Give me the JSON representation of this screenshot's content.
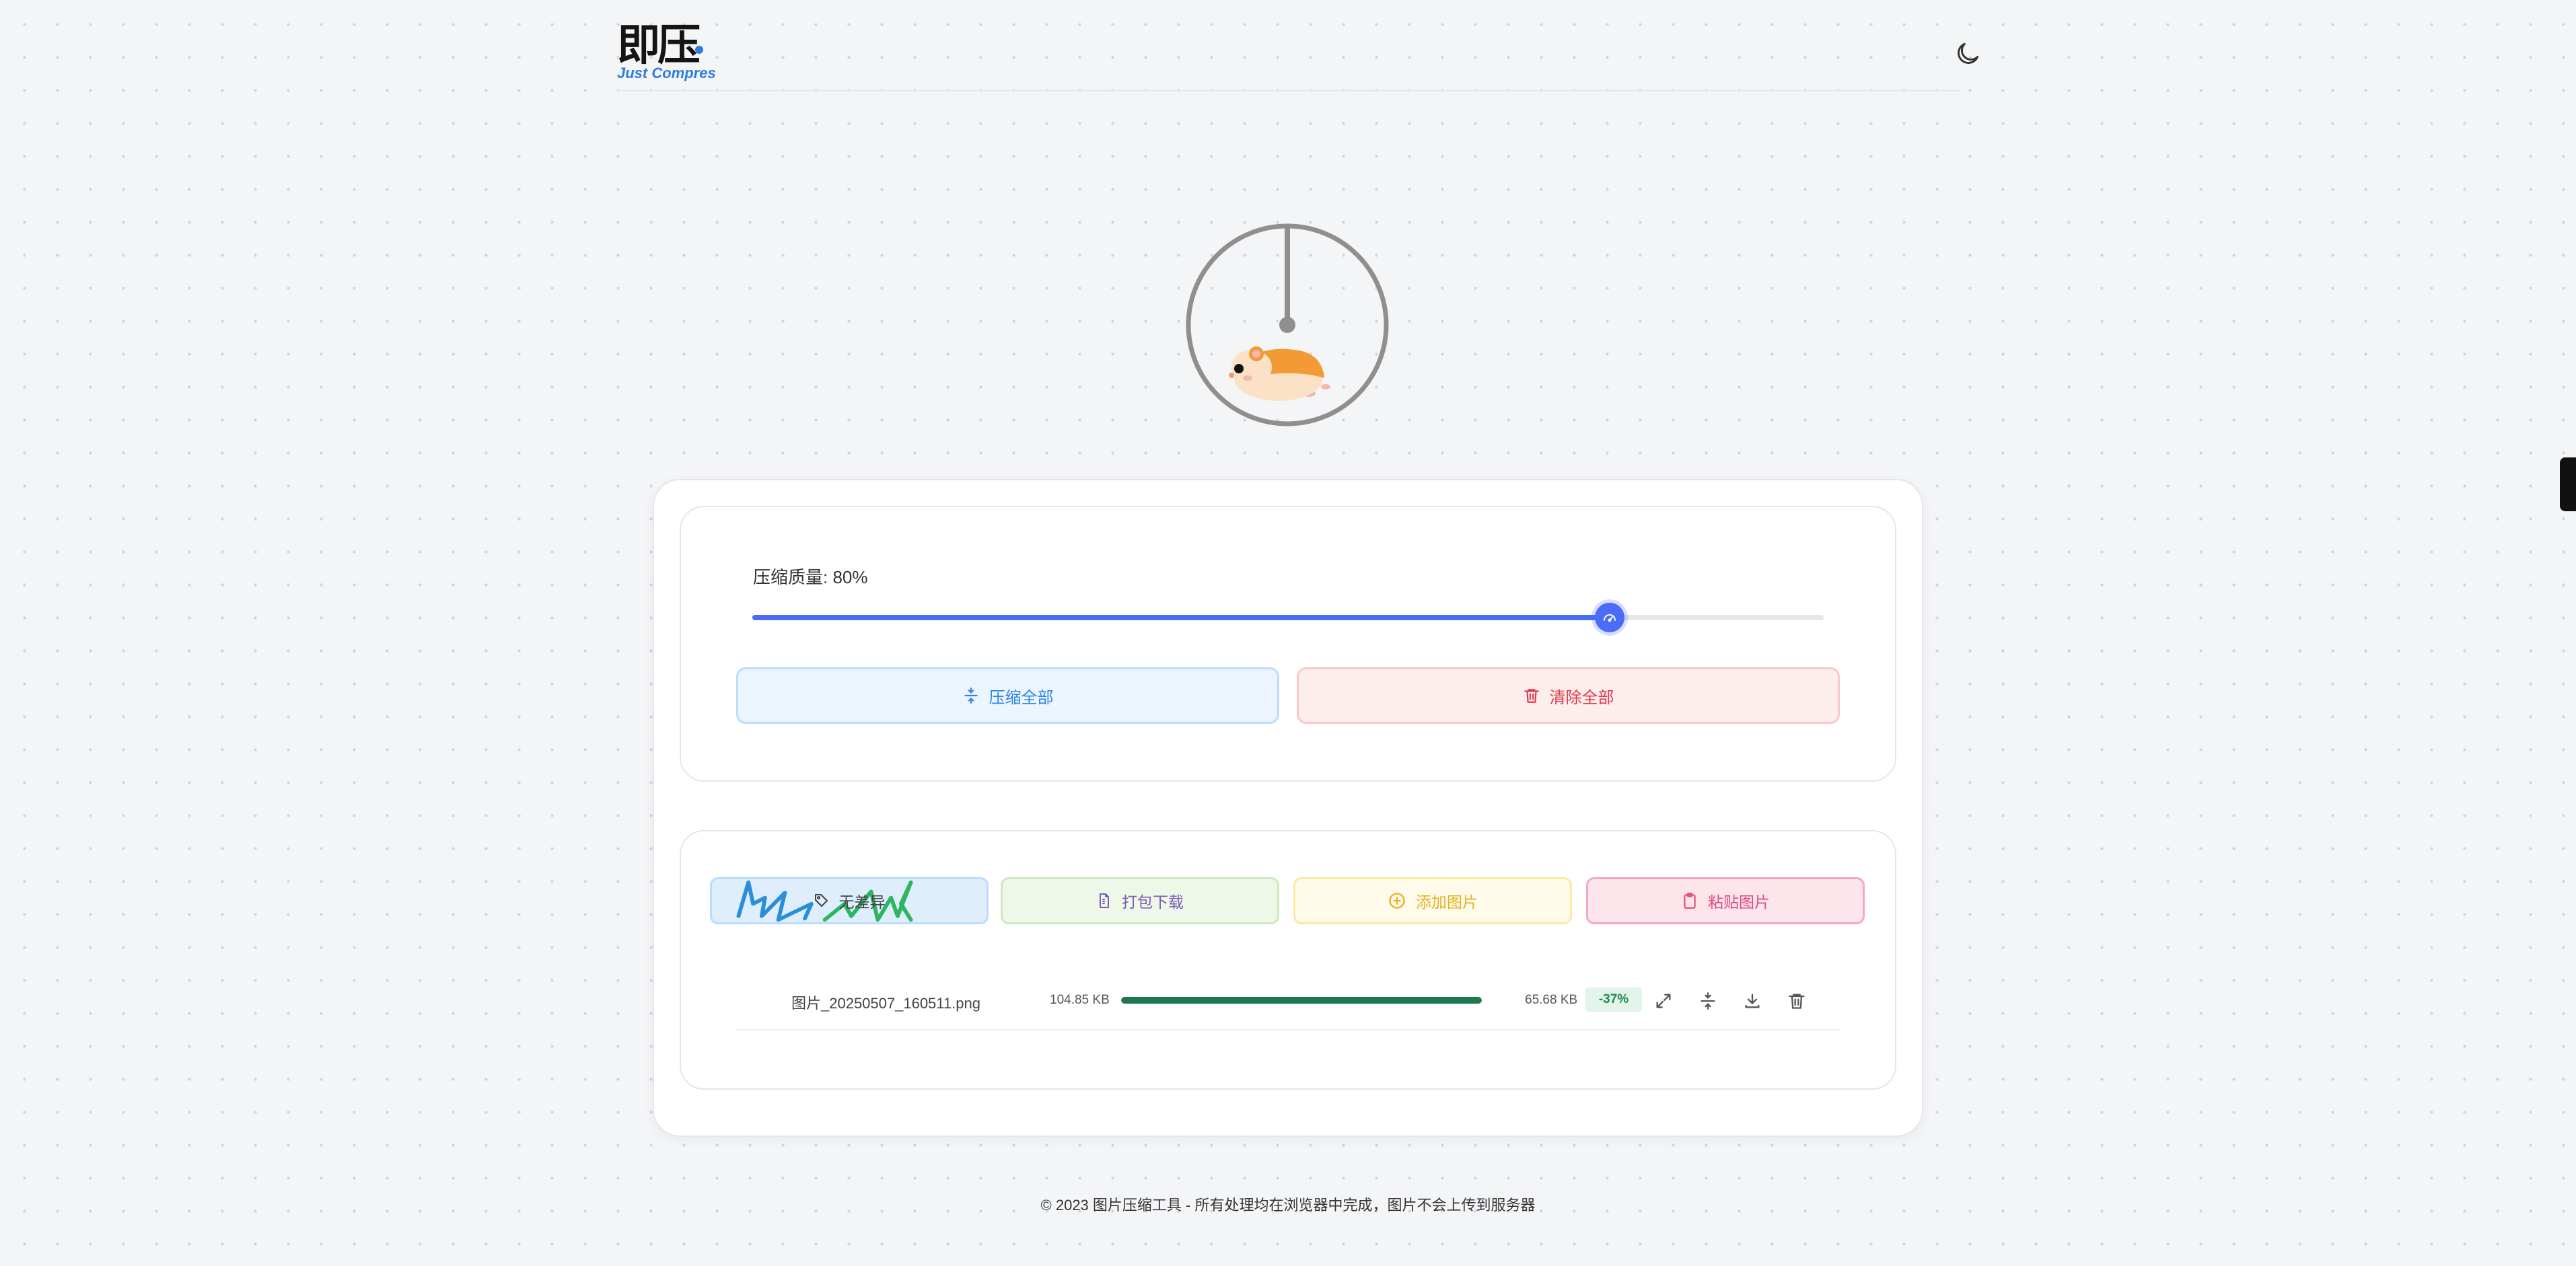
{
  "header": {
    "logo_text": "即压",
    "logo_subtitle": "Just Compres"
  },
  "settings": {
    "quality_label": "压缩质量: 80%",
    "quality_value": 80,
    "compress_all_label": "压缩全部",
    "clear_all_label": "清除全部"
  },
  "toolbar": {
    "no_diff_label": "无差异",
    "zip_download_label": "打包下载",
    "add_image_label": "添加图片",
    "paste_image_label": "粘贴图片"
  },
  "files": [
    {
      "name": "图片_20250507_160511.png",
      "original_size": "104.85 KB",
      "progress_percent": 100,
      "compressed_size": "65.68 KB",
      "ratio": "-37%"
    }
  ],
  "footer": {
    "text": "© 2023 图片压缩工具 - 所有处理均在浏览器中完成，图片不会上传到服务器"
  },
  "colors": {
    "accent": "#4a6cf7",
    "progress": "#1d7a4f",
    "danger": "#e23a4a",
    "info": "#2c86e8"
  }
}
